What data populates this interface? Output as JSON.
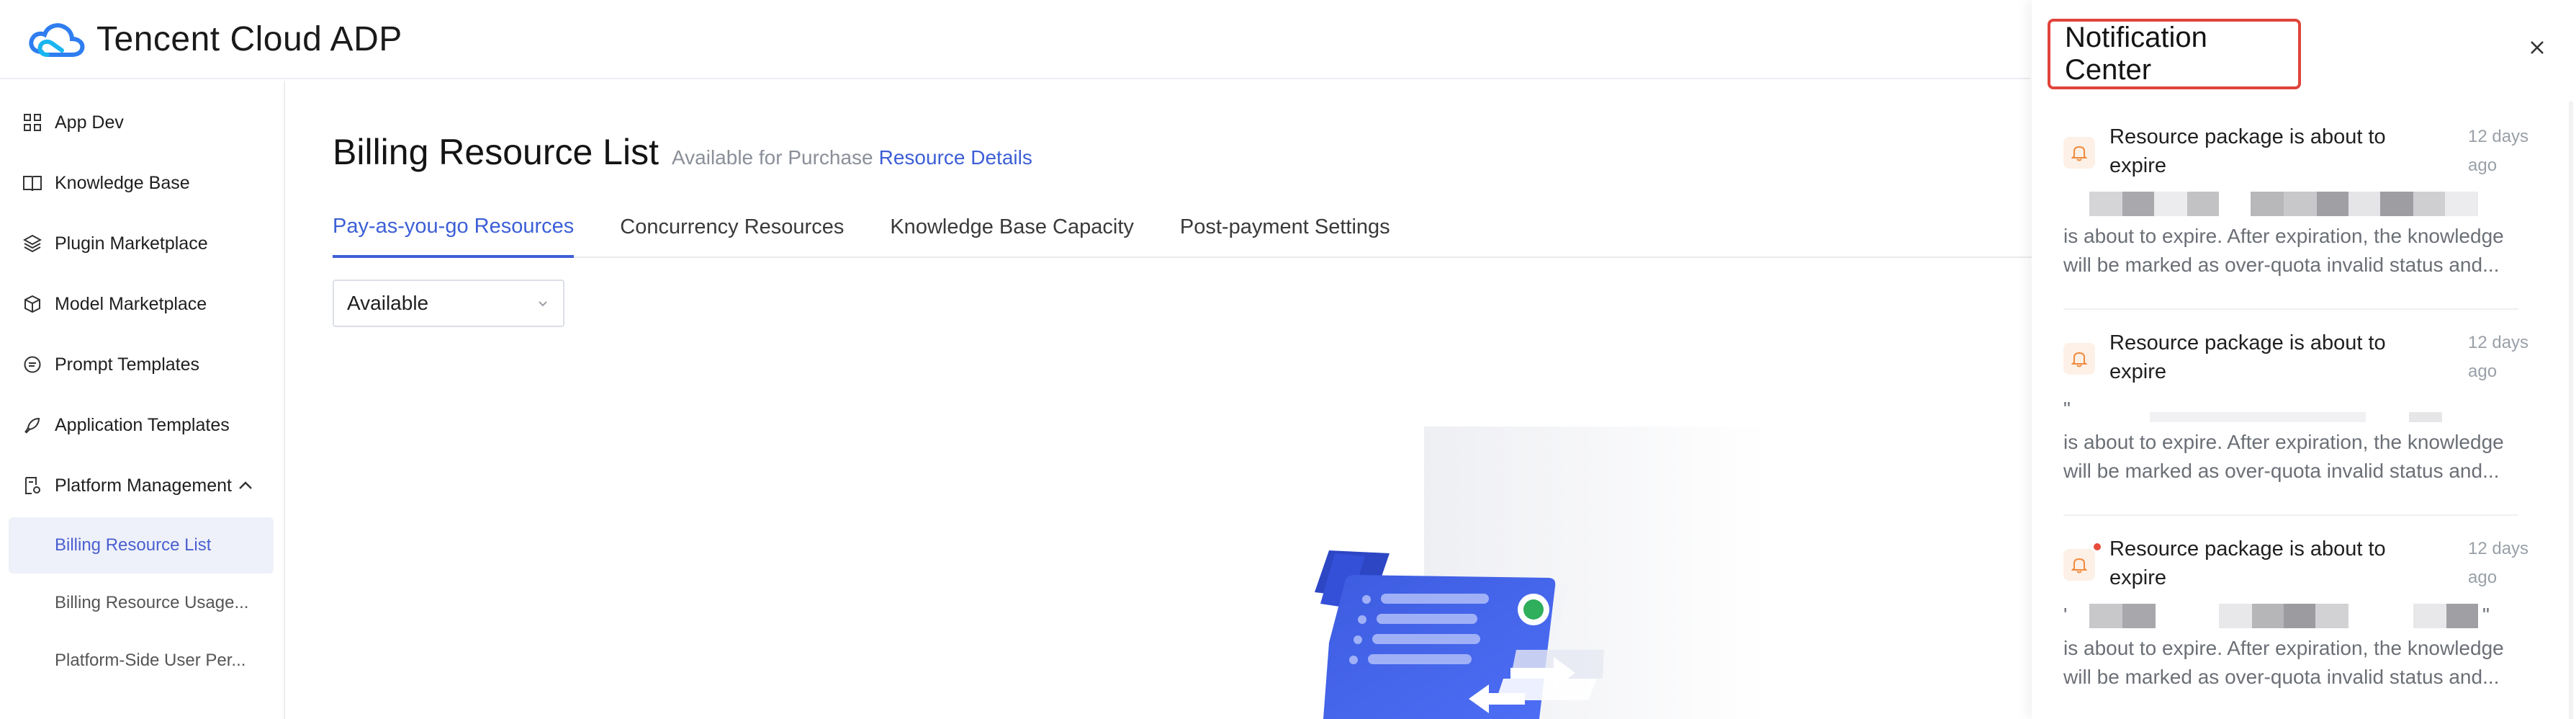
{
  "brand": {
    "name": "Tencent Cloud ADP",
    "logo_icon": "cloud-logo-icon",
    "accent": "#3c5fd6"
  },
  "sidebar": {
    "items": [
      {
        "label": "App Dev",
        "icon": "grid-icon"
      },
      {
        "label": "Knowledge Base",
        "icon": "book-icon"
      },
      {
        "label": "Plugin Marketplace",
        "icon": "layers-icon"
      },
      {
        "label": "Model Marketplace",
        "icon": "cube-icon"
      },
      {
        "label": "Prompt Templates",
        "icon": "message-icon"
      },
      {
        "label": "Application Templates",
        "icon": "rocket-icon"
      },
      {
        "label": "Platform Management",
        "icon": "settings-doc-icon",
        "expanded": true
      }
    ],
    "subitems": [
      {
        "label": "Billing Resource List",
        "active": true
      },
      {
        "label": "Billing Resource Usage..."
      },
      {
        "label": "Platform-Side User Per..."
      }
    ]
  },
  "main": {
    "title": "Billing Resource List",
    "subtitle": "Available for Purchase",
    "subtitle_link": "Resource Details",
    "tabs": [
      {
        "label": "Pay-as-you-go Resources",
        "active": true
      },
      {
        "label": "Concurrency Resources"
      },
      {
        "label": "Knowledge Base Capacity"
      },
      {
        "label": "Post-payment Settings"
      }
    ],
    "filter": {
      "value": "Available"
    }
  },
  "drawer": {
    "title": "Notification Center",
    "notifications": [
      {
        "title": "Resource package is about to expire",
        "time": "12 days ago",
        "prefix": "",
        "body": "is about to expire. After expiration, the knowledge will be marked as over-quota invalid status and...",
        "unread": false
      },
      {
        "title": "Resource package is about to expire",
        "time": "12 days ago",
        "prefix": "\"",
        "body": "is about to expire. After expiration, the knowledge will be marked as over-quota invalid status and...",
        "unread": false
      },
      {
        "title": "Resource package is about to expire",
        "time": "12 days ago",
        "prefix": "'",
        "body": "is about to expire. After expiration, the knowledge will be marked as over-quota invalid status and...",
        "unread": true
      }
    ]
  }
}
